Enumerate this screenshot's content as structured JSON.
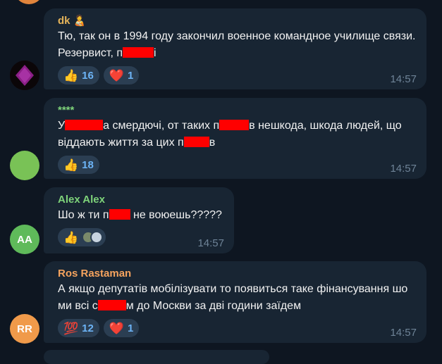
{
  "messages": [
    {
      "author": "dk",
      "author_emoji": "🧑‍🍼",
      "author_color": "#e5b45a",
      "text_a": "Тю, так он в 1994 году закончил военное командное училище связи. Резервист, ",
      "text_b": "п",
      "text_c": "",
      "reactions": [
        {
          "emoji": "👍",
          "count": "16"
        },
        {
          "emoji": "❤️",
          "count": "1"
        }
      ],
      "time": "14:57"
    },
    {
      "author": "****",
      "author_color": "#7ed37a",
      "text_a": "У",
      "text_b": "а смердючі, от таких ",
      "text_c": "п",
      "text_d": "в нешкода, шкода людей, що віддають життя за цих ",
      "text_e": "п",
      "text_f": "в",
      "reactions": [
        {
          "emoji": "👍",
          "count": "18"
        }
      ],
      "time": "14:57"
    },
    {
      "author": "Alex Alex",
      "author_color": "#7ed37a",
      "text_a": "Шо ж ти ",
      "text_b": "п",
      "text_c": " не воюешь?????",
      "reactions": [
        {
          "emoji": "👍",
          "count": ""
        }
      ],
      "time": "14:57",
      "avatar_initials": "AA",
      "avatar_color": "#5fba5a"
    },
    {
      "author": "Ros Rastaman",
      "author_color": "#f5a35e",
      "text_a": "А якщо депутатів мобілізувати то появиться таке фінансування шо ми всі ",
      "text_b": "с",
      "text_c": "м до Москви за дві години заїдем",
      "reactions": [
        {
          "emoji": "💯",
          "count": "12"
        },
        {
          "emoji": "❤️",
          "count": "1"
        }
      ],
      "time": "14:57",
      "avatar_initials": "RR",
      "avatar_color": "#f09a4a"
    }
  ]
}
